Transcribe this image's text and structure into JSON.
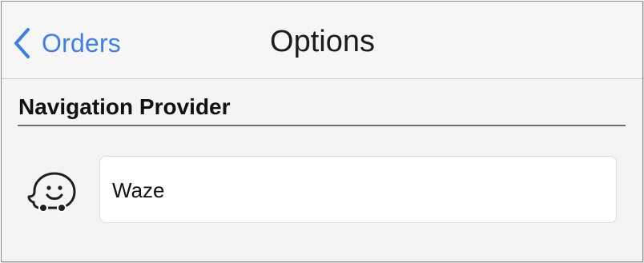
{
  "navbar": {
    "back_label": "Orders",
    "back_icon": "chevron-left-icon",
    "title": "Options",
    "accent_color": "#3f7fe3"
  },
  "section": {
    "title": "Navigation Provider"
  },
  "provider": {
    "icon": "waze-icon",
    "value": "Waze"
  }
}
